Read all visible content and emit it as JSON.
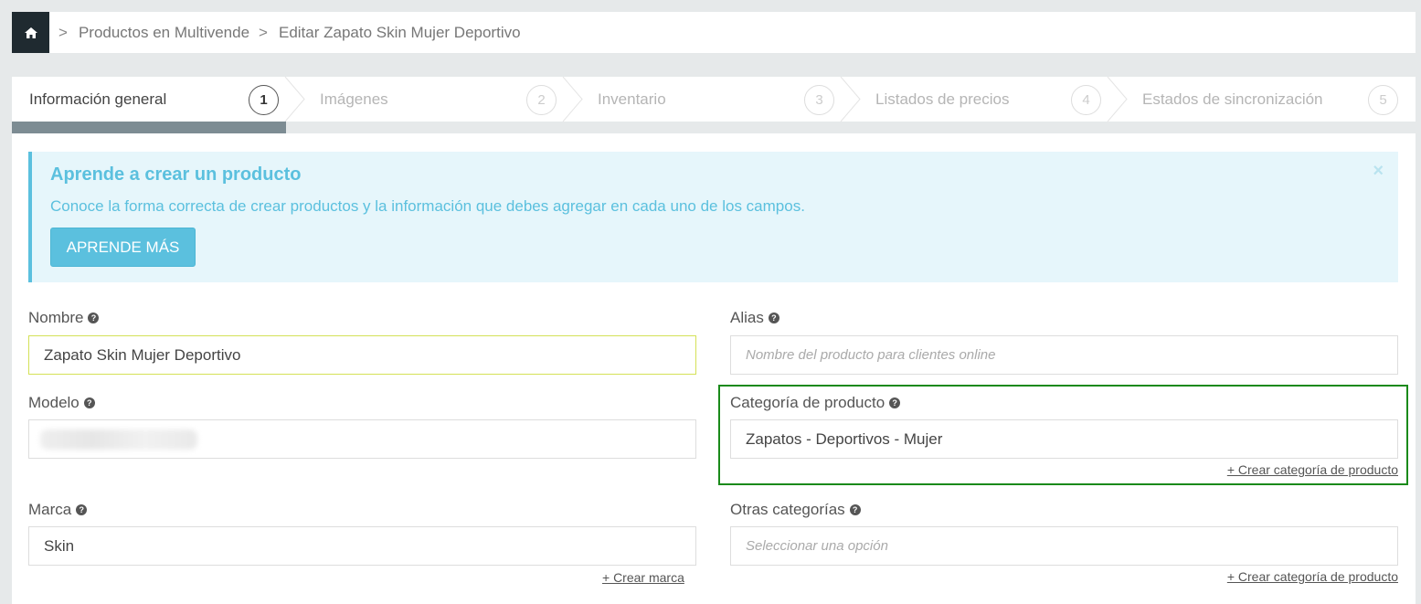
{
  "breadcrumb": {
    "items": [
      "Productos en Multivende",
      "Editar Zapato Skin Mujer Deportivo"
    ]
  },
  "steps": [
    {
      "label": "Información general",
      "num": "1"
    },
    {
      "label": "Imágenes",
      "num": "2"
    },
    {
      "label": "Inventario",
      "num": "3"
    },
    {
      "label": "Listados de precios",
      "num": "4"
    },
    {
      "label": "Estados de sincronización",
      "num": "5"
    }
  ],
  "progress": {
    "completed_fraction": 0.195
  },
  "alert": {
    "title": "Aprende a crear un producto",
    "text": "Conoce la forma correcta de crear productos y la información que debes agregar en cada uno de los campos.",
    "button": "APRENDE MÁS",
    "close": "×"
  },
  "form": {
    "nombre": {
      "label": "Nombre",
      "value": "Zapato Skin Mujer Deportivo"
    },
    "alias": {
      "label": "Alias",
      "placeholder": "Nombre del producto para clientes online"
    },
    "modelo": {
      "label": "Modelo",
      "value": ""
    },
    "categoria": {
      "label": "Categoría de producto",
      "value": "Zapatos - Deportivos - Mujer",
      "create_link": "+ Crear categoría de producto"
    },
    "marca": {
      "label": "Marca",
      "value": "Skin",
      "create_link": "+ Crear marca"
    },
    "otras": {
      "label": "Otras categorías",
      "placeholder": "Seleccionar una opción",
      "create_link": "+ Crear categoría de producto"
    }
  },
  "colors": {
    "accent": "#5bc0de",
    "dark": "#1f2a30",
    "highlight": "#1a8a1a"
  }
}
